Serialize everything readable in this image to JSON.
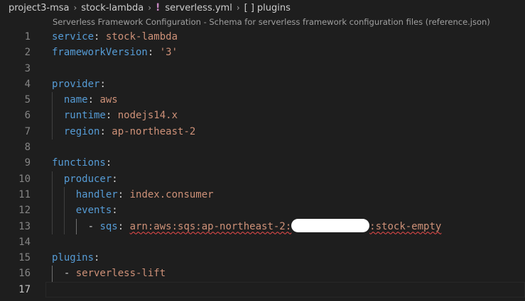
{
  "breadcrumb": {
    "items": [
      "project3-msa",
      "stock-lambda",
      "serverless.yml",
      "plugins"
    ],
    "separator": "›",
    "yaml_icon": "!",
    "array_icon": "[ ]"
  },
  "codelens": "Serverless Framework Configuration - Schema for serverless framework configuration files (reference.json)",
  "lines": [
    {
      "num": "1",
      "tokens": [
        {
          "t": "service",
          "c": "key"
        },
        {
          "t": ": ",
          "c": "punc"
        },
        {
          "t": "stock-lambda",
          "c": "str"
        }
      ]
    },
    {
      "num": "2",
      "tokens": [
        {
          "t": "frameworkVersion",
          "c": "key"
        },
        {
          "t": ": ",
          "c": "punc"
        },
        {
          "t": "'3'",
          "c": "str"
        }
      ]
    },
    {
      "num": "3",
      "tokens": []
    },
    {
      "num": "4",
      "tokens": [
        {
          "t": "provider",
          "c": "key"
        },
        {
          "t": ":",
          "c": "punc"
        }
      ]
    },
    {
      "num": "5",
      "tokens": [
        {
          "t": "  ",
          "c": "punc"
        },
        {
          "t": "name",
          "c": "key"
        },
        {
          "t": ": ",
          "c": "punc"
        },
        {
          "t": "aws",
          "c": "str"
        }
      ]
    },
    {
      "num": "6",
      "tokens": [
        {
          "t": "  ",
          "c": "punc"
        },
        {
          "t": "runtime",
          "c": "key"
        },
        {
          "t": ": ",
          "c": "punc"
        },
        {
          "t": "nodejs14.x",
          "c": "str"
        }
      ]
    },
    {
      "num": "7",
      "tokens": [
        {
          "t": "  ",
          "c": "punc"
        },
        {
          "t": "region",
          "c": "key"
        },
        {
          "t": ": ",
          "c": "punc"
        },
        {
          "t": "ap-northeast-2",
          "c": "str"
        }
      ]
    },
    {
      "num": "8",
      "tokens": []
    },
    {
      "num": "9",
      "tokens": [
        {
          "t": "functions",
          "c": "key"
        },
        {
          "t": ":",
          "c": "punc"
        }
      ]
    },
    {
      "num": "10",
      "tokens": [
        {
          "t": "  ",
          "c": "punc"
        },
        {
          "t": "producer",
          "c": "key"
        },
        {
          "t": ":",
          "c": "punc"
        }
      ]
    },
    {
      "num": "11",
      "tokens": [
        {
          "t": "    ",
          "c": "punc"
        },
        {
          "t": "handler",
          "c": "key"
        },
        {
          "t": ": ",
          "c": "punc"
        },
        {
          "t": "index.consumer",
          "c": "str"
        }
      ]
    },
    {
      "num": "12",
      "tokens": [
        {
          "t": "    ",
          "c": "punc"
        },
        {
          "t": "events",
          "c": "key"
        },
        {
          "t": ":",
          "c": "punc"
        }
      ]
    },
    {
      "num": "13",
      "tokens": [
        {
          "t": "      - ",
          "c": "punc"
        },
        {
          "t": "sqs",
          "c": "key"
        },
        {
          "t": ": ",
          "c": "punc"
        },
        {
          "t": "arn:aws:sqs:ap-northeast-2:",
          "c": "str squiggle"
        },
        {
          "t": "",
          "c": "redact"
        },
        {
          "t": ":stock-empty",
          "c": "str squiggle"
        }
      ]
    },
    {
      "num": "14",
      "tokens": []
    },
    {
      "num": "15",
      "tokens": [
        {
          "t": "plugins",
          "c": "key"
        },
        {
          "t": ":",
          "c": "punc"
        }
      ]
    },
    {
      "num": "16",
      "tokens": [
        {
          "t": "  - ",
          "c": "punc"
        },
        {
          "t": "serverless-lift",
          "c": "str"
        }
      ]
    },
    {
      "num": "17",
      "tokens": []
    }
  ],
  "active_line": "17",
  "colors": {
    "background": "#1e1e1e",
    "key": "#569cd6",
    "string": "#ce9178",
    "line_number": "#858585",
    "error": "#f14c4c"
  }
}
